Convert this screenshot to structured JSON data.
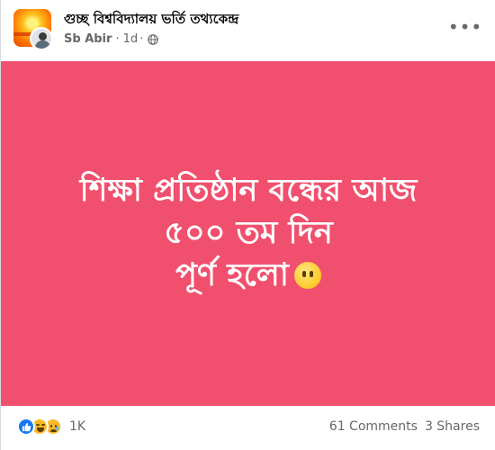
{
  "header": {
    "group_name": "গুচ্ছ বিশ্ববিদ্যালয় ভর্তি তথ্যকেন্দ্র",
    "author": "Sb Abir",
    "separator": "·",
    "time": "1d",
    "dot": "·",
    "privacy_icon": "globe-icon",
    "more_icon": "more-options-icon",
    "more_glyph": "•••"
  },
  "content": {
    "background_color": "#f0506e",
    "lines": [
      "শিক্ষা প্রতিষ্ঠান বন্ধের আজ",
      "৫০০ তম দিন",
      "পূর্ণ হলো"
    ],
    "emoji": "no-mouth-face-emoji"
  },
  "footer": {
    "reaction_icons": [
      "like-icon",
      "haha-icon",
      "sad-icon"
    ],
    "reaction_count": "1K",
    "comments": "61 Comments",
    "shares": "3 Shares"
  }
}
